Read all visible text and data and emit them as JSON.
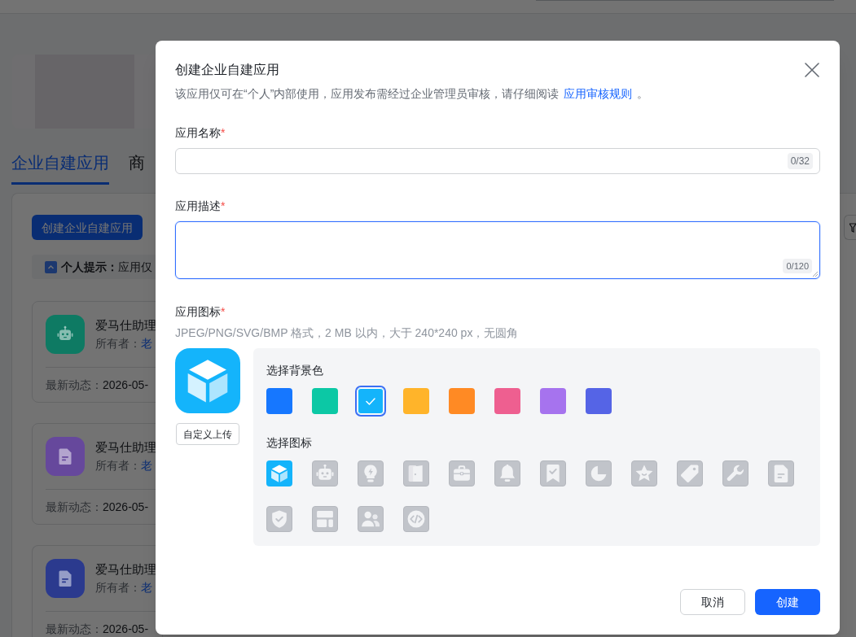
{
  "background_page": {
    "tabs": [
      {
        "label": "企业自建应用",
        "selected": true
      },
      {
        "label": "商",
        "selected": false
      }
    ],
    "create_button": "创建企业自建应用",
    "tip": "**个人提示：**应用仅",
    "apps": [
      {
        "kind": "robot",
        "color": "#0e7a63",
        "name": "爱马仕助理",
        "owner_label": "所有者：",
        "owner": "老",
        "activity_label": "最新动态：",
        "activity_date": "2026-05-"
      },
      {
        "kind": "document",
        "color": "#66489c",
        "name": "爱马仕助理",
        "owner_label": "所有者：",
        "owner": "老",
        "activity_label": "最新动态：",
        "activity_date": "2026-05-"
      },
      {
        "kind": "document",
        "color": "#2b3a8e",
        "name": "爱马仕助理",
        "owner_label": "所有者：",
        "owner": "老",
        "activity_label": "最新动态：",
        "activity_date": "2026-05-"
      }
    ]
  },
  "dialog": {
    "title": "创建企业自建应用",
    "description": {
      "before": "该应用仅可在“个人”内部使用，应用发布需经过企业管理员审核，请仔细阅读",
      "link": "应用审核规则",
      "after": "。"
    },
    "fields": [
      {
        "kind": "input",
        "label": "应用名称",
        "required_mark": "*",
        "counter": "0/32",
        "focused": false
      },
      {
        "kind": "textarea",
        "label": "应用描述",
        "required_mark": "*",
        "counter": "0/120",
        "focused": true
      }
    ],
    "icon_section": {
      "label": "应用图标",
      "required_mark": "*",
      "hint": "JPEG/PNG/SVG/BMP 格式，2 MB 以内，大于 240*240 px，无圆角",
      "upload_button": "自定义上传",
      "color_heading": "选择背景色",
      "colors": [
        {
          "color": "#1677ff",
          "selected": false
        },
        {
          "color": "#0cc8a5",
          "selected": false
        },
        {
          "color": "#14b4fb",
          "selected": true
        },
        {
          "color": "#ffb42a",
          "selected": false
        },
        {
          "color": "#ff8a24",
          "selected": false
        },
        {
          "color": "#ee5f90",
          "selected": false
        },
        {
          "color": "#a673ee",
          "selected": false
        },
        {
          "color": "#5564e6",
          "selected": false
        }
      ],
      "icon_heading": "选择图标",
      "icons": [
        {
          "kind": "cube",
          "selected": true
        },
        {
          "kind": "robot",
          "selected": false
        },
        {
          "kind": "lightbulb",
          "selected": false
        },
        {
          "kind": "door",
          "selected": false
        },
        {
          "kind": "briefcase",
          "selected": false
        },
        {
          "kind": "bell",
          "selected": false
        },
        {
          "kind": "bookmark",
          "selected": false
        },
        {
          "kind": "pie",
          "selected": false
        },
        {
          "kind": "star",
          "selected": false
        },
        {
          "kind": "tag",
          "selected": false
        },
        {
          "kind": "wrench",
          "selected": false
        },
        {
          "kind": "document",
          "selected": false
        },
        {
          "kind": "shield",
          "selected": false
        },
        {
          "kind": "layout",
          "selected": false
        },
        {
          "kind": "users",
          "selected": false
        },
        {
          "kind": "code",
          "selected": false
        }
      ]
    },
    "buttons": [
      {
        "kind": "secondary",
        "label": "取消"
      },
      {
        "kind": "primary",
        "label": "创建"
      }
    ]
  }
}
